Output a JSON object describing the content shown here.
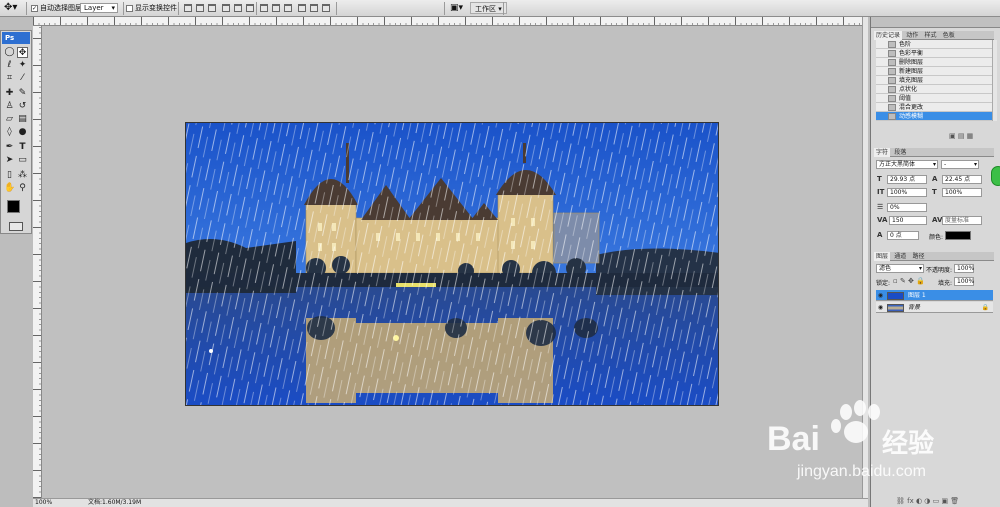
{
  "options_bar": {
    "auto_select_label": "自动选择图层",
    "auto_select_value": "Layer",
    "show_transform_label": "显示变换控件",
    "workspace_label": "工作区"
  },
  "toolbox": {
    "logo": "Ps"
  },
  "history": {
    "tabs": [
      "历史记录",
      "动作",
      "样式",
      "色板"
    ],
    "items": [
      "色阶",
      "色彩平衡",
      "删除图层",
      "新建图层",
      "填充图层",
      "点状化",
      "阈值",
      "混合更改",
      "动感模糊"
    ],
    "selected_index": 8
  },
  "character": {
    "tabs": [
      "字符",
      "段落"
    ],
    "font_family": "方正大黑简体",
    "font_style": "-",
    "font_size": "29.93 点",
    "leading": "22.45 点",
    "v_scale": "100%",
    "h_scale": "100%",
    "tracking": "0%",
    "kerning": "150",
    "kerning_mode": "度量标准",
    "baseline": "0 点",
    "color_label": "颜色:"
  },
  "layers": {
    "tabs": [
      "图层",
      "通道",
      "路径"
    ],
    "blend_mode": "滤色",
    "opacity_label": "不透明度:",
    "opacity": "100%",
    "lock_label": "锁定:",
    "fill_label": "填充:",
    "fill": "100%",
    "items": [
      {
        "name": "图层 1",
        "selected": true
      },
      {
        "name": "背景",
        "selected": false
      }
    ]
  },
  "status": {
    "zoom": "100%",
    "doc_info": "文档:1.60M/3.19M"
  },
  "watermark": {
    "brand": "Bai",
    "brand2": "经验",
    "url": "jingyan.baidu.com"
  },
  "colors": {
    "accent": "#3a8ee6",
    "sky": "#1f5fd0",
    "foreground": "#000000",
    "background": "#ffffff"
  }
}
